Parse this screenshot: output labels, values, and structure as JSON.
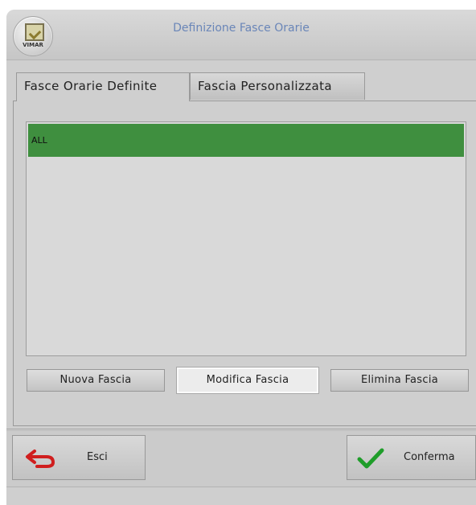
{
  "window": {
    "title": "Definizione Fasce Orarie",
    "logo_text": "VIMAR"
  },
  "tabs": [
    {
      "label": "Fasce Orarie Definite",
      "active": true
    },
    {
      "label": "Fascia Personalizzata",
      "active": false
    }
  ],
  "list": {
    "items": [
      {
        "label": "ALL",
        "selected": true
      }
    ]
  },
  "actions": {
    "new_label": "Nuova Fascia",
    "edit_label": "Modifica Fascia",
    "delete_label": "Elimina Fascia"
  },
  "footer": {
    "exit_label": "Esci",
    "confirm_label": "Conferma"
  },
  "colors": {
    "selected_row": "#3f8f3f",
    "title_text": "#6a86b8",
    "exit_icon": "#d01e1e",
    "confirm_icon": "#1f9d2a"
  },
  "icons": {
    "logo": "vimar-logo-icon",
    "exit": "back-arrow-icon",
    "confirm": "checkmark-icon"
  }
}
